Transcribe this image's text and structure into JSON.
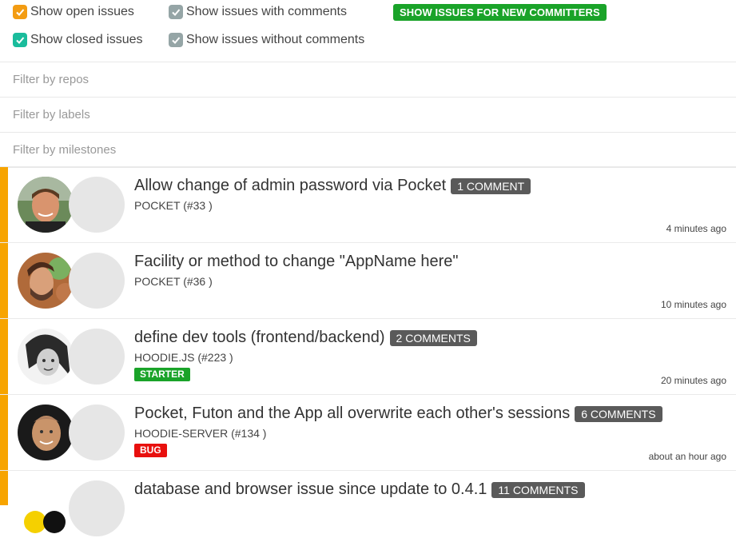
{
  "filters": {
    "checkboxes": [
      {
        "label": "Show open issues",
        "color": "#f39c12"
      },
      {
        "label": "Show issues with comments",
        "color": "#95a5a6"
      },
      {
        "label": "Show closed issues",
        "color": "#1abc9c"
      },
      {
        "label": "Show issues without comments",
        "color": "#95a5a6"
      }
    ],
    "new_committers_button": "SHOW ISSUES FOR NEW COMMITTERS",
    "repos_placeholder": "Filter by repos",
    "labels_placeholder": "Filter by labels",
    "milestones_placeholder": "Filter by milestones"
  },
  "issues": [
    {
      "title": "Allow change of admin password via Pocket",
      "comments": "1 COMMENT",
      "repo": "POCKET (#33 )",
      "label": "",
      "time": "4 minutes ago"
    },
    {
      "title": "Facility or method to change \"AppName here\"",
      "comments": "",
      "repo": "POCKET (#36 )",
      "label": "",
      "time": "10 minutes ago"
    },
    {
      "title": "define dev tools (frontend/backend)",
      "comments": "2 COMMENTS",
      "repo": "HOODIE.JS (#223 )",
      "label": "STARTER",
      "label_color": "#1aa329",
      "time": "20 minutes ago"
    },
    {
      "title": "Pocket, Futon and the App all overwrite each other's sessions",
      "comments": "6 COMMENTS",
      "repo": "HOODIE-SERVER (#134 )",
      "label": "BUG",
      "label_color": "#e8100e",
      "time": "about an hour ago"
    },
    {
      "title": "database and browser issue since update to 0.4.1",
      "comments": "11 COMMENTS",
      "repo": "",
      "label": "",
      "time": ""
    }
  ],
  "colors": {
    "accent_bar": "#f7a400"
  }
}
